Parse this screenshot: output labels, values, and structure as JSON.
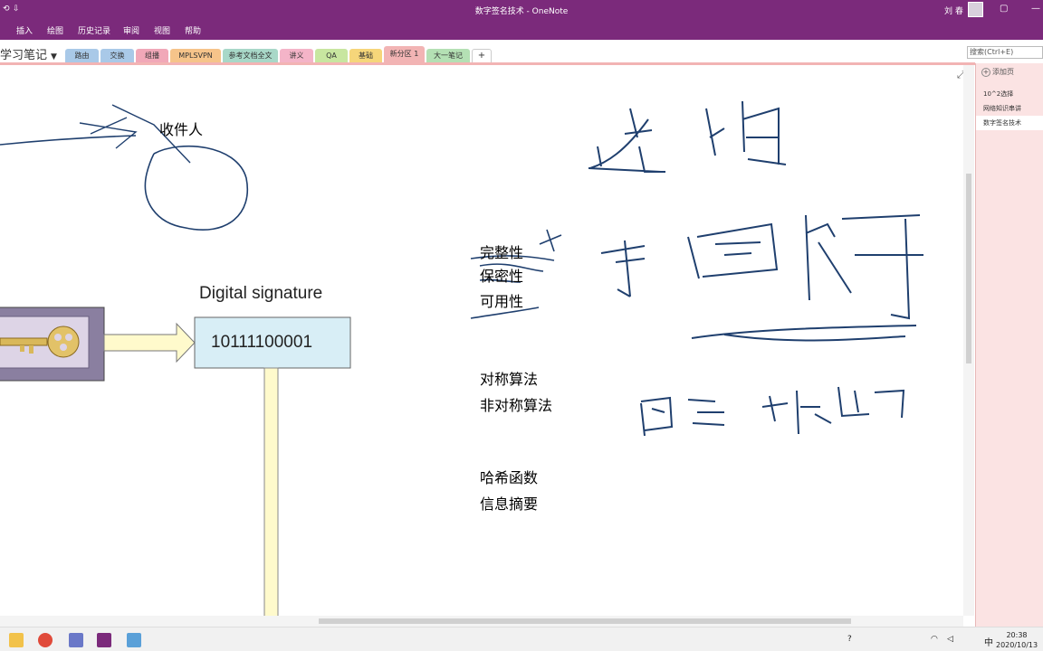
{
  "window": {
    "title": "数字签名技术 - OneNote",
    "user": "刘 春",
    "quick_access": [
      "⟲",
      "⇩"
    ],
    "controls": [
      "▢",
      "—",
      "▢",
      "✕"
    ]
  },
  "ribbon": {
    "tabs": [
      "插入",
      "绘图",
      "历史记录",
      "审阅",
      "视图",
      "帮助"
    ]
  },
  "notebook": {
    "name": "学习笔记",
    "dropdown": "▼",
    "search_placeholder": "搜索(Ctrl+E)"
  },
  "sections": [
    {
      "label": "路由",
      "color": "#a9c9e8"
    },
    {
      "label": "交换",
      "color": "#a9c9e8"
    },
    {
      "label": "组播",
      "color": "#f1a8b8"
    },
    {
      "label": "MPLSVPN",
      "color": "#f6c48a"
    },
    {
      "label": "参考文档全文",
      "color": "#a8d8c8"
    },
    {
      "label": "讲义",
      "color": "#f4b4c8"
    },
    {
      "label": "QA",
      "color": "#c8e6a0"
    },
    {
      "label": "基础",
      "color": "#f6d67a"
    },
    {
      "label": "新分区 1",
      "color": "#f2b4b4"
    },
    {
      "label": "大一笔记",
      "color": "#b4e0b4"
    }
  ],
  "add_section": "+",
  "pages": {
    "add_label": "添加页",
    "items": [
      {
        "label": "10^2选择"
      },
      {
        "label": "网络知识串讲"
      },
      {
        "label": "数字签名技术"
      }
    ]
  },
  "canvas": {
    "recipient": "收件人",
    "diagram_title": "Digital signature",
    "signature_value": "10111100001",
    "props": [
      "完整性",
      "保密性",
      "可用性"
    ],
    "algos": [
      "对称算法",
      "非对称算法"
    ],
    "hash": [
      "哈希函数",
      "信息摘要"
    ],
    "expand_icon": "⤢"
  },
  "taskbar": {
    "time": "20:38",
    "date": "2020/10/13",
    "ime": "中"
  }
}
